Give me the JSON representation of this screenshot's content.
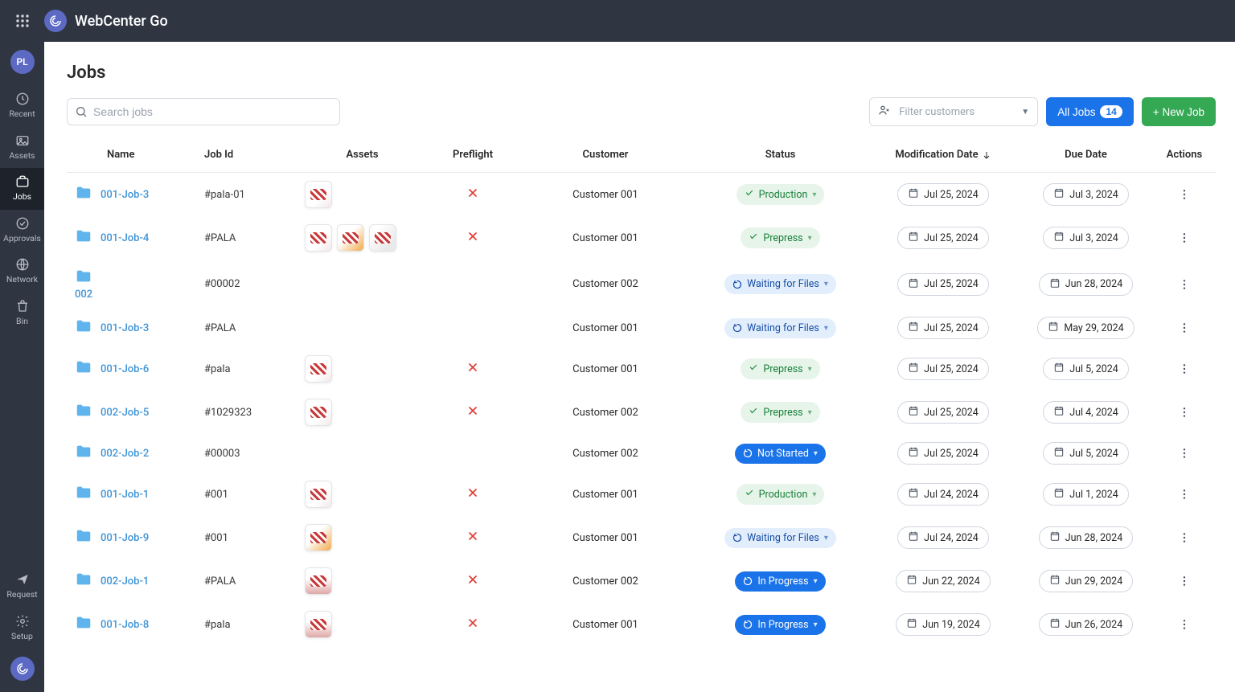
{
  "app": {
    "title": "WebCenter Go"
  },
  "user": {
    "initials": "PL"
  },
  "sidebar": {
    "items": [
      {
        "label": "Recent",
        "icon": "clock"
      },
      {
        "label": "Assets",
        "icon": "image"
      },
      {
        "label": "Jobs",
        "icon": "briefcase",
        "active": true
      },
      {
        "label": "Approvals",
        "icon": "check"
      },
      {
        "label": "Network",
        "icon": "globe"
      },
      {
        "label": "Bin",
        "icon": "trash"
      }
    ],
    "bottom": [
      {
        "label": "Request",
        "icon": "send"
      },
      {
        "label": "Setup",
        "icon": "gear"
      }
    ]
  },
  "page": {
    "title": "Jobs",
    "search_placeholder": "Search jobs",
    "filter_placeholder": "Filter customers",
    "all_jobs_label": "All Jobs",
    "all_jobs_count": "14",
    "new_job_label": "+ New Job"
  },
  "columns": {
    "name": "Name",
    "job_id": "Job Id",
    "assets": "Assets",
    "preflight": "Preflight",
    "customer": "Customer",
    "status": "Status",
    "mod_date": "Modification Date",
    "due_date": "Due Date",
    "actions": "Actions"
  },
  "rows": [
    {
      "name": "001-Job-3",
      "job_id": "#pala-01",
      "assets": [
        "light"
      ],
      "preflight": "fail",
      "customer": "Customer 001",
      "status": {
        "label": "Production",
        "kind": "production"
      },
      "mod": "Jul 25, 2024",
      "due": "Jul 3, 2024"
    },
    {
      "name": "001-Job-4",
      "job_id": "#PALA",
      "assets": [
        "light",
        "accent",
        "cards"
      ],
      "preflight": "fail",
      "customer": "Customer 001",
      "status": {
        "label": "Prepress",
        "kind": "prepress"
      },
      "mod": "Jul 25, 2024",
      "due": "Jul 3, 2024"
    },
    {
      "name": "002",
      "job_id": "#00002",
      "assets": [],
      "preflight": "",
      "customer": "Customer 002",
      "status": {
        "label": "Waiting for Files",
        "kind": "waiting"
      },
      "mod": "Jul 25, 2024",
      "due": "Jun 28, 2024",
      "wrap": true
    },
    {
      "name": "001-Job-3",
      "job_id": "#PALA",
      "assets": [],
      "preflight": "",
      "customer": "Customer 001",
      "status": {
        "label": "Waiting for Files",
        "kind": "waiting"
      },
      "mod": "Jul 25, 2024",
      "due": "May 29, 2024"
    },
    {
      "name": "001-Job-6",
      "job_id": "#pala",
      "assets": [
        "light"
      ],
      "preflight": "fail",
      "customer": "Customer 001",
      "status": {
        "label": "Prepress",
        "kind": "prepress"
      },
      "mod": "Jul 25, 2024",
      "due": "Jul 5, 2024"
    },
    {
      "name": "002-Job-5",
      "job_id": "#1029323",
      "assets": [
        "light"
      ],
      "preflight": "fail",
      "customer": "Customer 002",
      "status": {
        "label": "Prepress",
        "kind": "prepress"
      },
      "mod": "Jul 25, 2024",
      "due": "Jul 4, 2024"
    },
    {
      "name": "002-Job-2",
      "job_id": "#00003",
      "assets": [],
      "preflight": "",
      "customer": "Customer 002",
      "status": {
        "label": "Not Started",
        "kind": "notstarted"
      },
      "mod": "Jul 25, 2024",
      "due": "Jul 5, 2024"
    },
    {
      "name": "001-Job-1",
      "job_id": "#001",
      "assets": [
        "light"
      ],
      "preflight": "fail",
      "customer": "Customer 001",
      "status": {
        "label": "Production",
        "kind": "production"
      },
      "mod": "Jul 24, 2024",
      "due": "Jul 1, 2024"
    },
    {
      "name": "001-Job-9",
      "job_id": "#001",
      "assets": [
        "accent"
      ],
      "preflight": "fail",
      "customer": "Customer 001",
      "status": {
        "label": "Waiting for Files",
        "kind": "waiting"
      },
      "mod": "Jul 24, 2024",
      "due": "Jun 28, 2024"
    },
    {
      "name": "002-Job-1",
      "job_id": "#PALA",
      "assets": [
        "red"
      ],
      "preflight": "fail",
      "customer": "Customer 002",
      "status": {
        "label": "In Progress",
        "kind": "inprogress"
      },
      "mod": "Jun 22, 2024",
      "due": "Jun 29, 2024"
    },
    {
      "name": "001-Job-8",
      "job_id": "#pala",
      "assets": [
        "red"
      ],
      "preflight": "fail",
      "customer": "Customer 001",
      "status": {
        "label": "In Progress",
        "kind": "inprogress"
      },
      "mod": "Jun 19, 2024",
      "due": "Jun 26, 2024"
    }
  ]
}
